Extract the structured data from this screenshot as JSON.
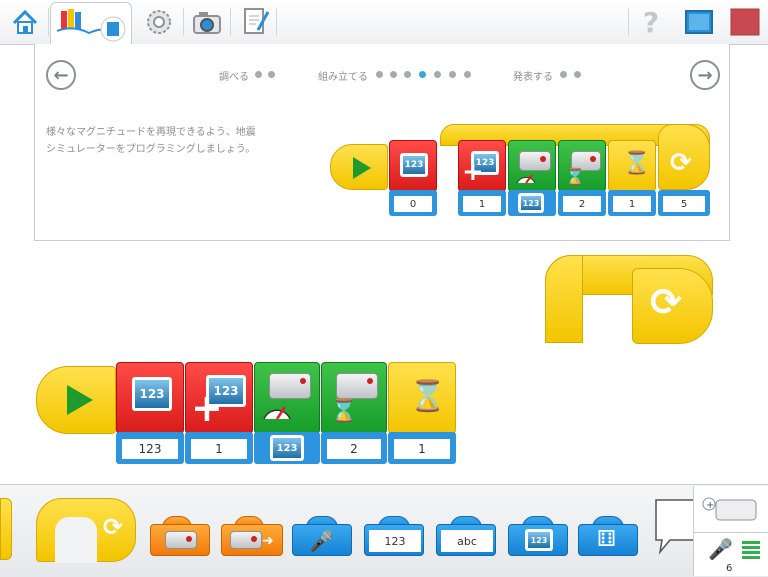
{
  "toolbar": {
    "icons": [
      "home-icon",
      "documentation-icon",
      "settings-gear-icon",
      "camera-icon",
      "notebook-icon",
      "help-icon",
      "screen-icon",
      "stop-icon"
    ]
  },
  "lesson": {
    "steps": [
      {
        "label": "調べる",
        "dots": 2,
        "active_dot": -1
      },
      {
        "label": "組み立てる",
        "dots": 6,
        "active_dot": 3
      },
      {
        "label": "発表する",
        "dots": 2,
        "active_dot": -1
      }
    ],
    "instruction": "様々なマグニチュードを再現できるよう、地震シミュレーターをプログラミングしましょう。",
    "example_program": {
      "screen_value": "123",
      "fields": [
        "0",
        "1",
        "123",
        "2",
        "1",
        "5"
      ]
    }
  },
  "canvas_program": {
    "screen_value": "123",
    "fields": [
      "123",
      "1",
      "123",
      "2",
      "1"
    ]
  },
  "palette": {
    "text_input": "123",
    "text_input_abc": "abc",
    "screen_value": "123",
    "device_count": "6"
  },
  "colors": {
    "start": "#f3c500",
    "display": "#d91b1b",
    "motor": "#189c2a",
    "flow": "#f3c500",
    "sensor": "#f07a0a",
    "input": "#1682d4"
  }
}
